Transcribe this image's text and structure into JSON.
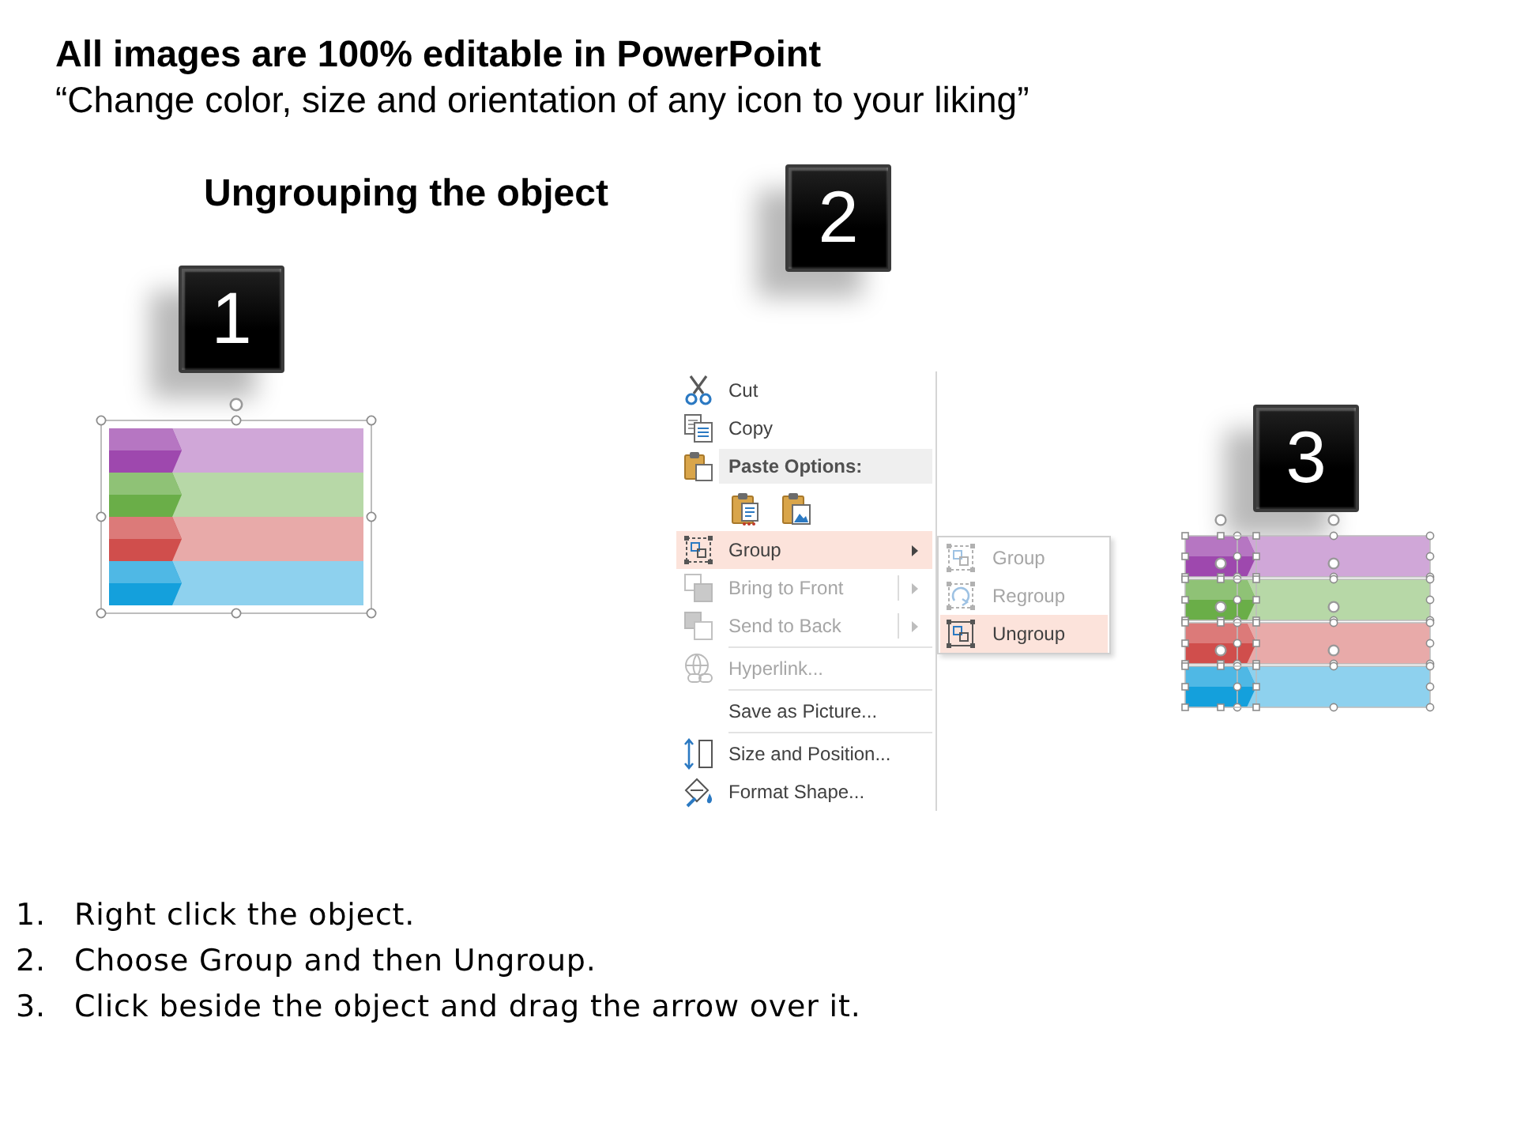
{
  "header": {
    "title": "All images are 100% editable in PowerPoint",
    "subtitle": "“Change color, size and orientation of any icon to your liking”"
  },
  "section_title": "Ungrouping the object",
  "panels": [
    {
      "kind": "shape",
      "badge": "1",
      "grouped": true,
      "rows": [
        {
          "color": "#9e48ae"
        },
        {
          "color": "#6aae48"
        },
        {
          "color": "#d04e4c"
        },
        {
          "color": "#14a0dc"
        }
      ]
    },
    {
      "kind": "menu",
      "badge": "2",
      "menu": {
        "items": [
          {
            "kind": "command",
            "label": "Cut",
            "disabled": false,
            "selected": false,
            "has_submenu": false,
            "separator_after": false
          },
          {
            "kind": "command",
            "label": "Copy",
            "disabled": false,
            "selected": false,
            "has_submenu": false,
            "separator_after": false
          },
          {
            "kind": "header",
            "label": "Paste Options:"
          },
          {
            "kind": "paste-options"
          },
          {
            "kind": "command",
            "label": "Group",
            "disabled": false,
            "selected": true,
            "has_submenu": true,
            "split": false,
            "separator_after": false,
            "submenu": [
              {
                "label": "Group",
                "disabled": true,
                "selected": false
              },
              {
                "label": "Regroup",
                "disabled": true,
                "selected": false
              },
              {
                "label": "Ungroup",
                "disabled": false,
                "selected": true
              }
            ]
          },
          {
            "kind": "command",
            "label": "Bring to Front",
            "disabled": true,
            "selected": false,
            "has_submenu": true,
            "split": true,
            "separator_after": false
          },
          {
            "kind": "command",
            "label": "Send to Back",
            "disabled": true,
            "selected": false,
            "has_submenu": true,
            "split": true,
            "separator_after": true
          },
          {
            "kind": "command",
            "label": "Hyperlink...",
            "disabled": true,
            "selected": false,
            "has_submenu": false,
            "separator_after": true
          },
          {
            "kind": "command",
            "label": "Save as Picture...",
            "disabled": false,
            "selected": false,
            "has_submenu": false,
            "separator_after": true
          },
          {
            "kind": "command",
            "label": "Size and Position...",
            "disabled": false,
            "selected": false,
            "has_submenu": false,
            "separator_after": false
          },
          {
            "kind": "command",
            "label": "Format Shape...",
            "disabled": false,
            "selected": false,
            "has_submenu": false,
            "separator_after": false
          }
        ]
      }
    },
    {
      "kind": "shape",
      "badge": "3",
      "grouped": false,
      "rows": [
        {
          "color": "#9e48ae"
        },
        {
          "color": "#6aae48"
        },
        {
          "color": "#d04e4c"
        },
        {
          "color": "#14a0dc"
        }
      ]
    }
  ],
  "steps": [
    {
      "number": "1.",
      "text": "Right click the object."
    },
    {
      "number": "2.",
      "text": "Choose Group and then Ungroup."
    },
    {
      "number": "3.",
      "text": "Click beside the object and drag the arrow over it."
    }
  ]
}
